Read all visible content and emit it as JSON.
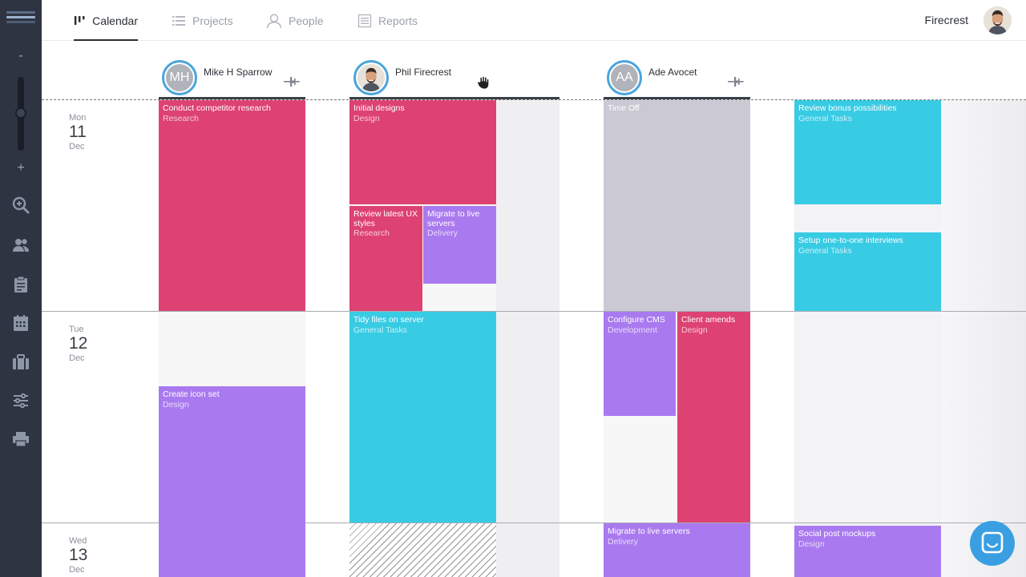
{
  "nav": {
    "tabs": [
      {
        "label": "Calendar",
        "icon": "bars-icon",
        "active": true
      },
      {
        "label": "Projects",
        "icon": "list-icon",
        "active": false
      },
      {
        "label": "People",
        "icon": "person-icon",
        "active": false
      },
      {
        "label": "Reports",
        "icon": "report-icon",
        "active": false
      }
    ],
    "user_name": "Firecrest"
  },
  "sidebar": {
    "zoom_minus": "-",
    "zoom_plus": "+",
    "zoom_level": 0.5,
    "icons": [
      "search-icon",
      "people-icon",
      "clipboard-icon",
      "calendar-icon",
      "briefcase-icon",
      "sliders-icon",
      "print-icon"
    ]
  },
  "people": [
    {
      "initials": "MH",
      "name": "Mike H Sparrow",
      "photo": false
    },
    {
      "initials": "",
      "name": "Phil Firecrest",
      "photo": true
    },
    {
      "initials": "AA",
      "name": "Ade Avocet",
      "photo": false
    }
  ],
  "days": [
    {
      "dow": "Mon",
      "num": "11",
      "mon": "Dec"
    },
    {
      "dow": "Tue",
      "num": "12",
      "mon": "Dec"
    },
    {
      "dow": "Wed",
      "num": "13",
      "mon": "Dec"
    }
  ],
  "tasks": [
    {
      "title": "Conduct competitor research",
      "project": "Research",
      "color": "#dd4272"
    },
    {
      "title": "Create icon set",
      "project": "Design",
      "color": "#a97aef"
    },
    {
      "title": "Initial designs",
      "project": "Design",
      "color": "#dd4272"
    },
    {
      "title": "Review latest UX styles",
      "project": "Research",
      "color": "#dd4272"
    },
    {
      "title": "Migrate to live servers",
      "project": "Delivery",
      "color": "#a97aef"
    },
    {
      "title": "Tidy files on server",
      "project": "General Tasks",
      "color": "#38cbe4"
    },
    {
      "title": "Time Off",
      "project": "",
      "color": "#cbcad4"
    },
    {
      "title": "Configure CMS",
      "project": "Development",
      "color": "#a97aef"
    },
    {
      "title": "Client amends",
      "project": "Design",
      "color": "#dd4272"
    },
    {
      "title": "Migrate to live servers",
      "project": "Delivery",
      "color": "#a97aef"
    },
    {
      "title": "Review bonus possibilities",
      "project": "General Tasks",
      "color": "#38cbe4"
    },
    {
      "title": "Setup one-to-one interviews",
      "project": "General Tasks",
      "color": "#38cbe4"
    },
    {
      "title": "Social post mockups",
      "project": "Design",
      "color": "#a97aef"
    }
  ]
}
